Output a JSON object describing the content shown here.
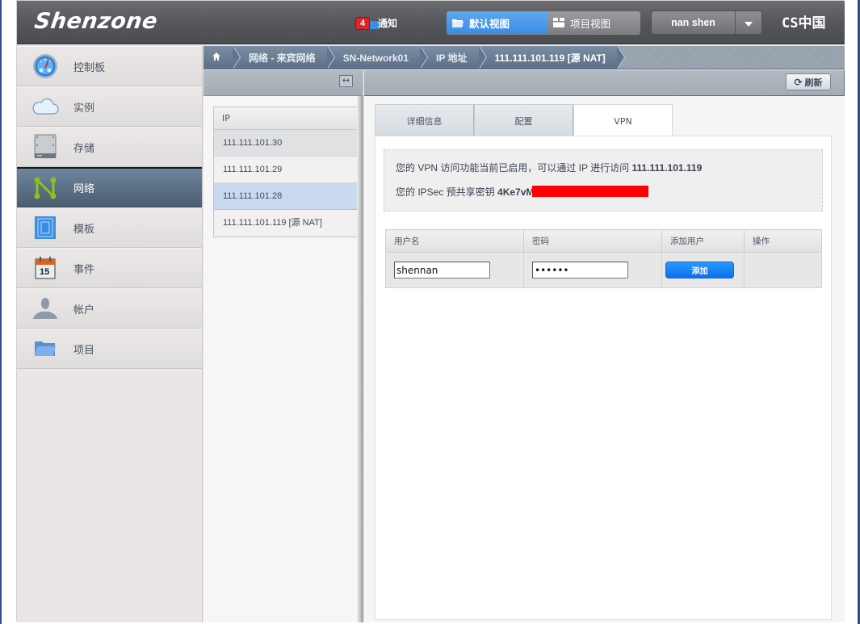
{
  "header": {
    "logo": "Shenzone",
    "notifications": {
      "count": "4",
      "label": "通知"
    },
    "views": [
      {
        "label": "默认视图",
        "icon": "folder-icon",
        "active": true
      },
      {
        "label": "项目视图",
        "icon": "project-icon",
        "active": false
      }
    ],
    "user": {
      "name": "nan shen"
    },
    "brand": "CS中国"
  },
  "sidebar": {
    "items": [
      {
        "label": "控制板",
        "icon": "dashboard-icon",
        "active": false
      },
      {
        "label": "实例",
        "icon": "cloud-icon",
        "active": false
      },
      {
        "label": "存储",
        "icon": "storage-icon",
        "active": false
      },
      {
        "label": "网络",
        "icon": "network-icon",
        "active": true
      },
      {
        "label": "模板",
        "icon": "template-icon",
        "active": false
      },
      {
        "label": "事件",
        "icon": "calendar-icon",
        "active": false
      },
      {
        "label": "帐户",
        "icon": "user-icon",
        "active": false
      },
      {
        "label": "项目",
        "icon": "folder-icon",
        "active": false
      }
    ],
    "calendar_day": "15"
  },
  "breadcrumb": [
    {
      "label": "",
      "icon": "home-icon"
    },
    {
      "label": "网络 - 来宾网络"
    },
    {
      "label": "SN-Network01"
    },
    {
      "label": "IP 地址"
    },
    {
      "label": "111.111.101.119 [源 NAT]"
    }
  ],
  "list": {
    "column": "IP",
    "rows": [
      {
        "ip": "111.111.101.30",
        "state": "hover"
      },
      {
        "ip": "111.111.101.29",
        "state": ""
      },
      {
        "ip": "111.111.101.28",
        "state": "selected"
      },
      {
        "ip": "111.111.101.119 [源 NAT]",
        "state": ""
      }
    ]
  },
  "detail": {
    "refresh_label": "刷新",
    "tabs": [
      {
        "label": "详细信息",
        "active": false
      },
      {
        "label": "配置",
        "active": false
      },
      {
        "label": "VPN",
        "active": true
      }
    ],
    "vpn": {
      "line1_prefix": "您的 VPN 访问功能当前已启用，可以通过 IP 进行访问 ",
      "line1_ip": "111.111.101.119",
      "line2_prefix": "您的 IPSec 预共享密钥 ",
      "line2_key": "4Ke7vM",
      "line2_redacted": true
    },
    "user_table": {
      "columns": [
        "用户名",
        "密码",
        "添加用户",
        "操作"
      ],
      "username_value": "shennan",
      "password_value": "••••••",
      "add_button": "添加"
    }
  }
}
